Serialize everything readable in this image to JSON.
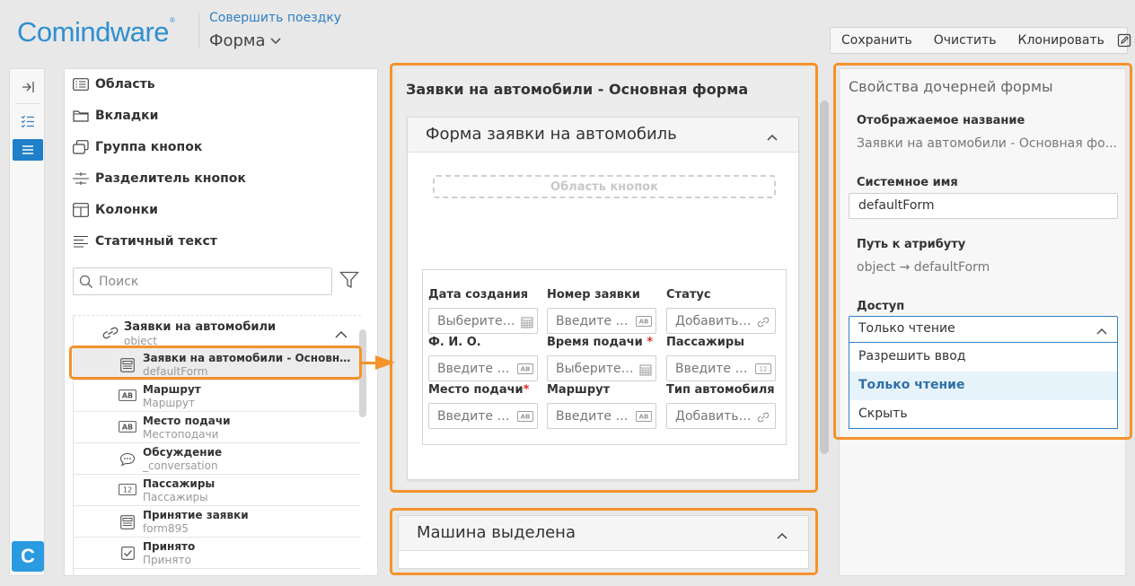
{
  "header": {
    "logo_text": "Comindware",
    "logo_mark": "®",
    "process_link": "Совершить поездку",
    "form_selector": "Форма"
  },
  "toolbar": {
    "save": "Сохранить",
    "clear": "Очистить",
    "clone": "Клонировать"
  },
  "strip": {
    "badge": "C"
  },
  "left_panel": {
    "categories": [
      {
        "label": "Область",
        "icon": "list-box-icon"
      },
      {
        "label": "Вкладки",
        "icon": "folder-icon"
      },
      {
        "label": "Группа кнопок",
        "icon": "button-group-icon"
      },
      {
        "label": "Разделитель кнопок",
        "icon": "button-separator-icon"
      },
      {
        "label": "Колонки",
        "icon": "columns-icon"
      },
      {
        "label": "Статичный текст",
        "icon": "text-lines-icon"
      }
    ],
    "search_placeholder": "Поиск",
    "tree": {
      "group": {
        "title": "Заявки на автомобили",
        "sub": "object"
      },
      "items": [
        {
          "title": "Заявки на автомобили - Основная форма",
          "sub": "defaultForm",
          "icon": "form-icon"
        },
        {
          "title": "Маршрут",
          "sub": "Маршрут",
          "icon": "text-ab-icon"
        },
        {
          "title": "Место подачи",
          "sub": "Местоподачи",
          "icon": "text-ab-icon"
        },
        {
          "title": "Обсуждение",
          "sub": "_conversation",
          "icon": "chat-icon"
        },
        {
          "title": "Пассажиры",
          "sub": "Пассажиры",
          "icon": "number-icon"
        },
        {
          "title": "Принятие заявки",
          "sub": "form895",
          "icon": "form-icon"
        },
        {
          "title": "Принято",
          "sub": "Принято",
          "icon": "checkbox-icon"
        }
      ]
    }
  },
  "center": {
    "title": "Заявки на автомобили - Основная форма",
    "form_card": {
      "title": "Форма заявки на автомобиль",
      "button_area": "Область кнопок",
      "fields": [
        {
          "label": "Дата создания",
          "placeholder": "Выберите дату",
          "required": "",
          "icon": "calendar-icon"
        },
        {
          "label": "Номер заявки",
          "placeholder": "Введите текст",
          "required": "",
          "icon": "text-ab-icon"
        },
        {
          "label": "Статус",
          "placeholder": "Добавить связь",
          "required": "",
          "icon": "link-icon"
        },
        {
          "label": "Ф. И. О.",
          "placeholder": "Введите текст",
          "required": "",
          "icon": "text-ab-icon"
        },
        {
          "label": "Время подачи",
          "placeholder": "Выберите дату",
          "required": "*",
          "icon": "calendar-icon"
        },
        {
          "label": "Пассажиры",
          "placeholder": "Введите число",
          "required": "",
          "icon": "number-icon"
        },
        {
          "label": "Место подачи",
          "placeholder": "Введите текст",
          "required": "*",
          "icon": "text-ab-icon"
        },
        {
          "label": "Маршрут",
          "placeholder": "Введите текст",
          "required": "",
          "icon": "text-ab-icon"
        },
        {
          "label": "Тип автомобиля",
          "placeholder": "Добавить связь",
          "required": "",
          "icon": "link-icon"
        }
      ]
    },
    "second_card": {
      "title": "Машина выделена"
    }
  },
  "right_panel": {
    "title": "Свойства дочерней формы",
    "display_name_label": "Отображаемое название",
    "display_name_value": "Заявки на автомобили - Основная фо...",
    "system_name_label": "Системное имя",
    "system_name_value": "defaultForm",
    "attr_path_label": "Путь к атрибуту",
    "attr_path_value": "object → defaultForm",
    "access_label": "Доступ",
    "access_selected": "Только чтение",
    "access_options": [
      "Разрешить ввод",
      "Только чтение",
      "Скрыть"
    ]
  },
  "colors": {
    "accent": "#2f7fc4",
    "highlight": "#f4922b",
    "logo": "#2f8fd0",
    "required": "#d9302c"
  }
}
